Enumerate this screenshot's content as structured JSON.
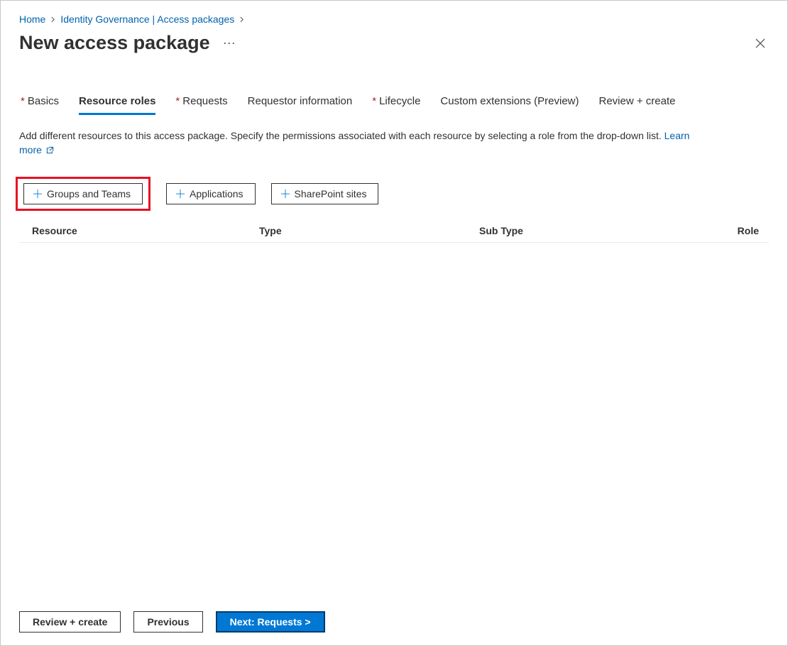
{
  "breadcrumb": {
    "home": "Home",
    "section": "Identity Governance | Access packages"
  },
  "header": {
    "title": "New access package"
  },
  "tabs": [
    {
      "label": "Basics",
      "required": true,
      "active": false
    },
    {
      "label": "Resource roles",
      "required": false,
      "active": true
    },
    {
      "label": "Requests",
      "required": true,
      "active": false
    },
    {
      "label": "Requestor information",
      "required": false,
      "active": false
    },
    {
      "label": "Lifecycle",
      "required": true,
      "active": false
    },
    {
      "label": "Custom extensions (Preview)",
      "required": false,
      "active": false
    },
    {
      "label": "Review + create",
      "required": false,
      "active": false
    }
  ],
  "description": {
    "text": "Add different resources to this access package. Specify the permissions associated with each resource by selecting a role from the drop-down list. ",
    "learn_more": "Learn more"
  },
  "add_buttons": {
    "groups": "Groups and Teams",
    "apps": "Applications",
    "sp": "SharePoint sites"
  },
  "table": {
    "col_resource": "Resource",
    "col_type": "Type",
    "col_subtype": "Sub Type",
    "col_role": "Role"
  },
  "footer": {
    "review": "Review + create",
    "previous": "Previous",
    "next": "Next: Requests >"
  }
}
